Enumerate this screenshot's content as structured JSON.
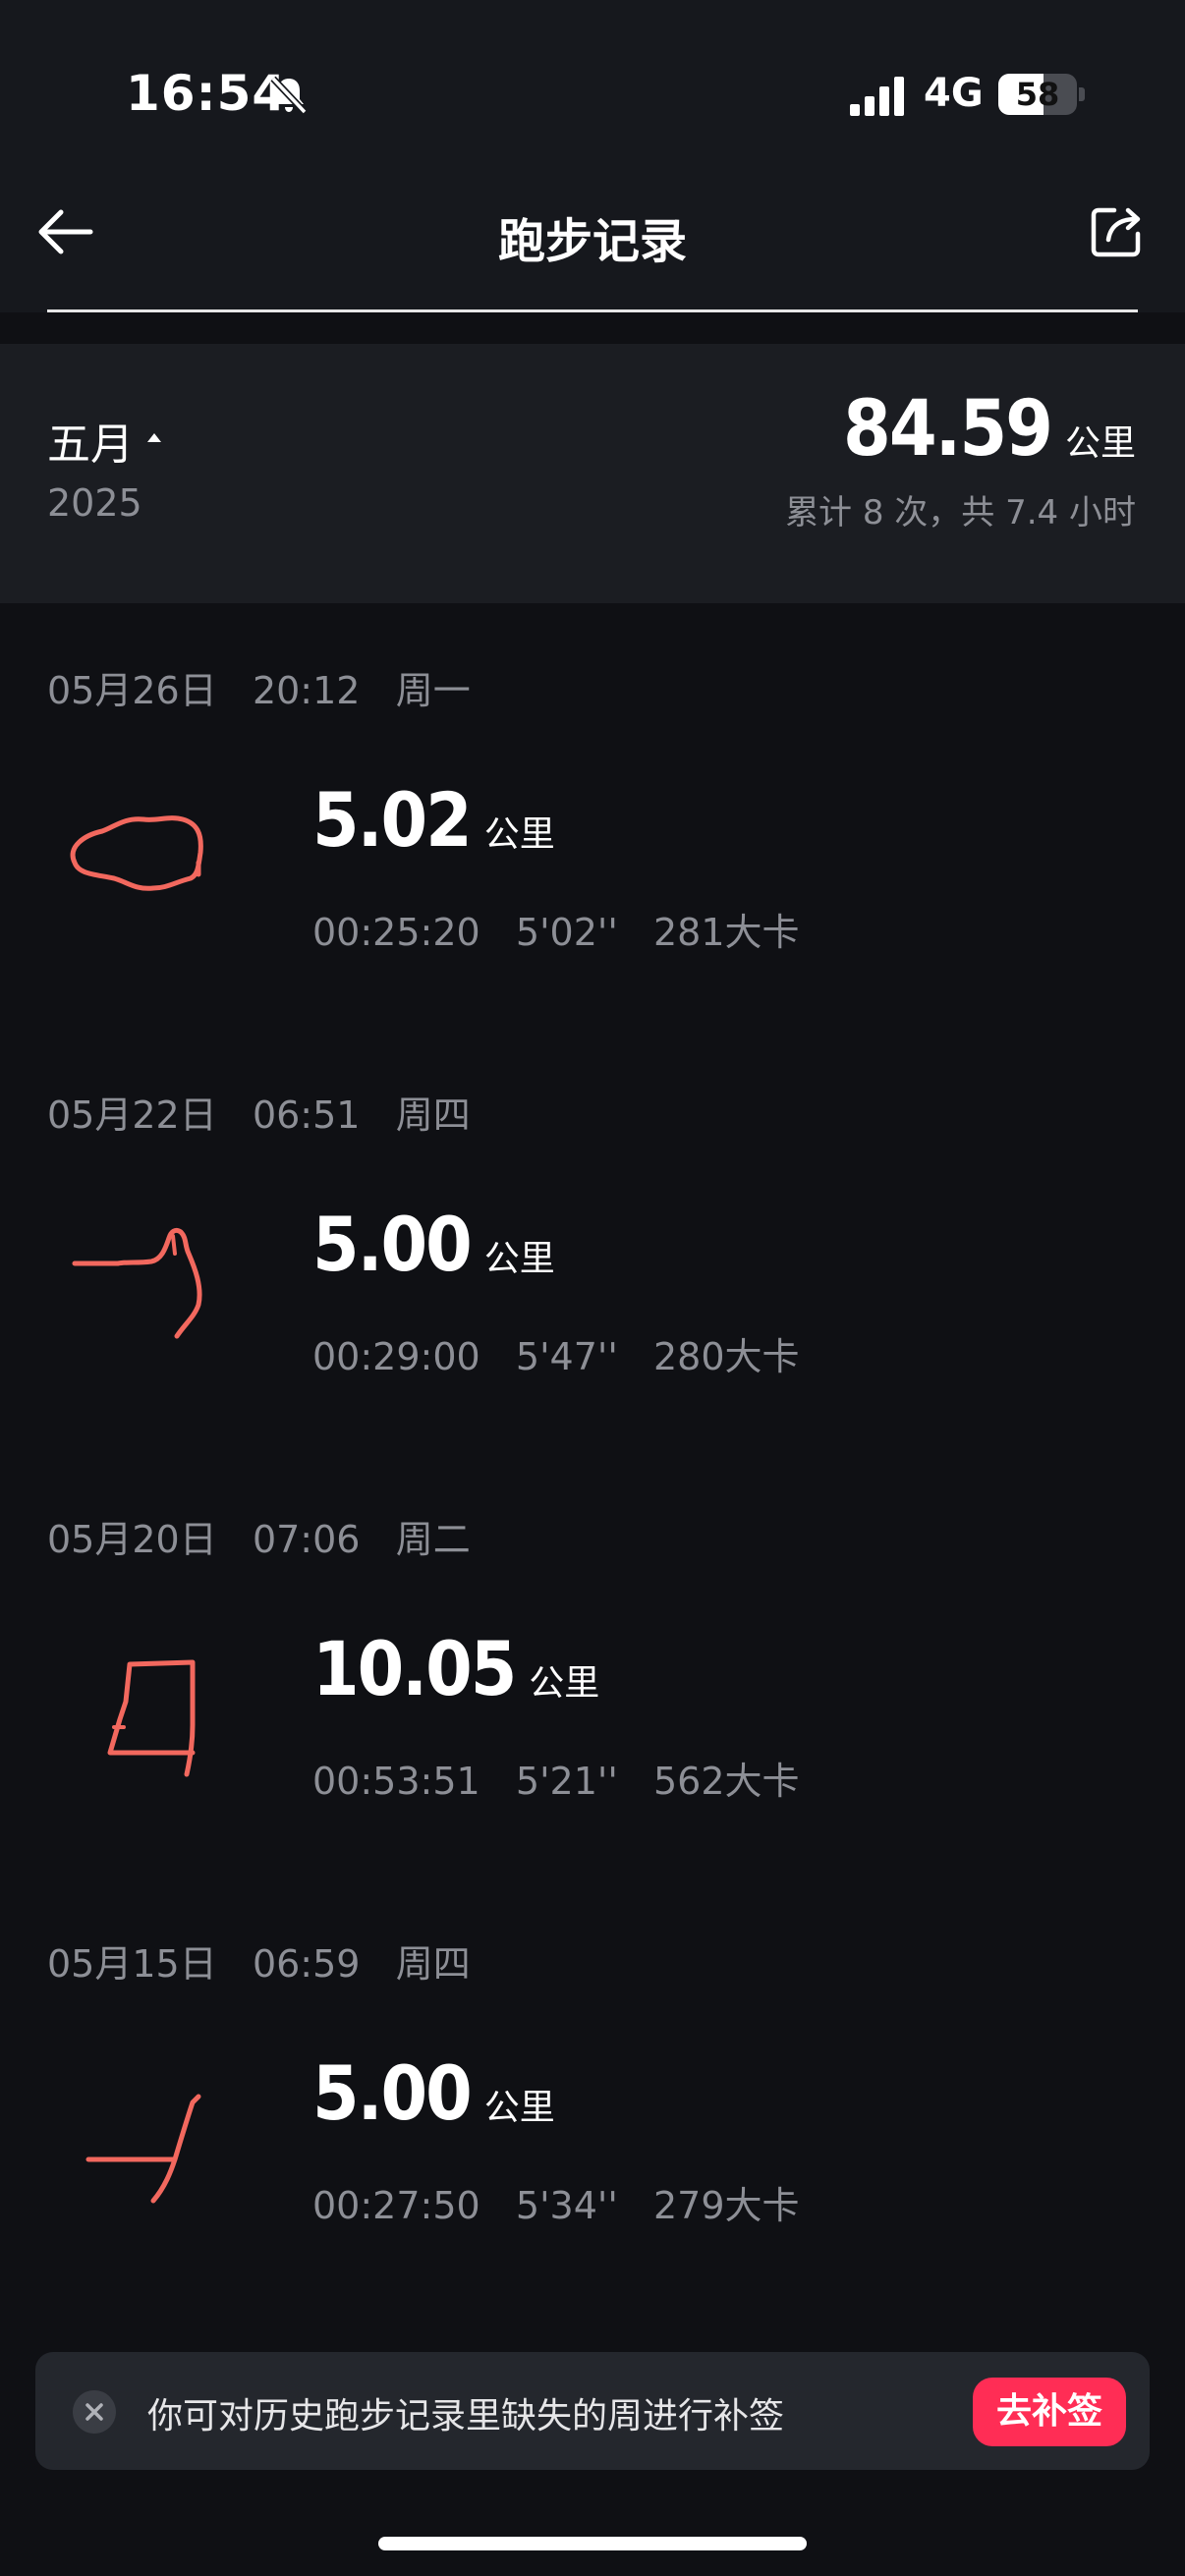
{
  "status_bar": {
    "time": "16:54",
    "network": "4G",
    "battery_level": 58,
    "battery_text": "58"
  },
  "header": {
    "title": "跑步记录"
  },
  "summary": {
    "month": "五月",
    "year": "2025",
    "total_distance": "84.59",
    "total_unit": "公里",
    "description": "累计 8 次，共 7.4 小时"
  },
  "records": [
    {
      "date": "05月26日   20:12   周一",
      "distance": "5.02",
      "unit": "公里",
      "stats": "00:25:20   5'02''   281大卡"
    },
    {
      "date": "05月22日   06:51   周四",
      "distance": "5.00",
      "unit": "公里",
      "stats": "00:29:00   5'47''   280大卡"
    },
    {
      "date": "05月20日   07:06   周二",
      "distance": "10.05",
      "unit": "公里",
      "stats": "00:53:51   5'21''   562大卡"
    },
    {
      "date": "05月15日   06:59   周四",
      "distance": "5.00",
      "unit": "公里",
      "stats": "00:27:50   5'34''   279大卡"
    }
  ],
  "banner": {
    "text": "你可对历史跑步记录里缺失的周进行补签",
    "button_label": "去补签"
  },
  "colors": {
    "route": "#f2685e",
    "accent": "#ff2d55",
    "background": "#0f1014"
  }
}
